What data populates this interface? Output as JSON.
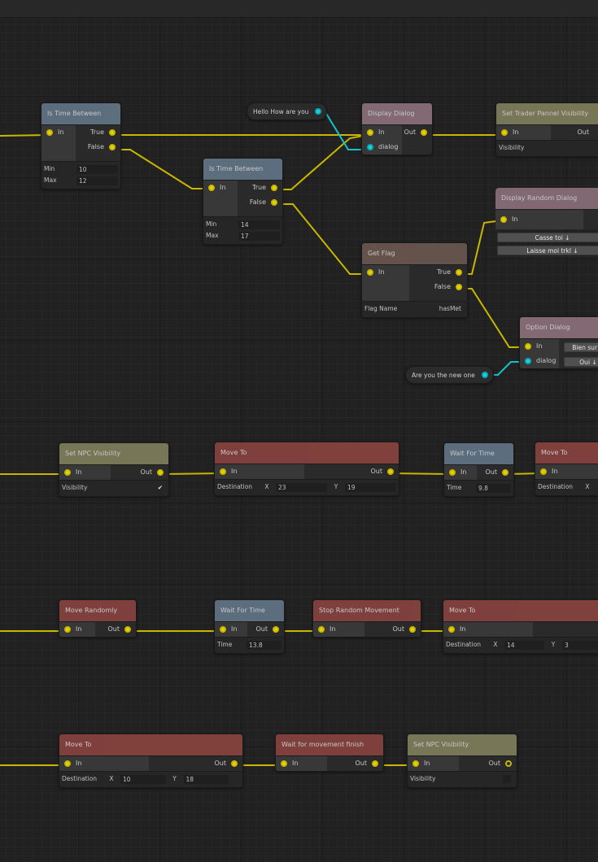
{
  "colors": {
    "exec_wire": "#c9b600",
    "data_wire": "#13c2cf",
    "header_condition": "#667a8c",
    "header_dialog": "#937580",
    "header_visibility": "#858460",
    "header_flag": "#6f5a52",
    "header_movement": "#8f4440"
  },
  "labels": {
    "in": "In",
    "out": "Out",
    "true": "True",
    "false": "False",
    "dialog": "dialog",
    "min": "Min",
    "max": "Max",
    "visibility": "Visibility",
    "destination": "Destination",
    "x": "X",
    "y": "Y",
    "time": "Time",
    "flag_name": "Flag Name",
    "check_mark": "✔"
  },
  "nodes": {
    "is_time_between_1": {
      "title": "Is Time Between",
      "min": "10",
      "max": "12"
    },
    "is_time_between_2": {
      "title": "Is Time Between",
      "min": "14",
      "max": "17"
    },
    "hello_bubble": {
      "text": "Hello How are you"
    },
    "display_dialog": {
      "title": "Display Dialog"
    },
    "set_trader_visibility": {
      "title": "Set Trader Pannel Visibility"
    },
    "display_random_dialog": {
      "title": "Display Random Dialog",
      "options": [
        "Casse toi ↓",
        "Laisse moi trkl ↓"
      ]
    },
    "get_flag": {
      "title": "Get Flag",
      "flag_name": "hasMet"
    },
    "option_dialog": {
      "title": "Option Dialog",
      "options": [
        "Bien sur ↓",
        "Oui ↓"
      ]
    },
    "are_you_bubble": {
      "text": "Are you the new one"
    },
    "set_npc_visibility_1": {
      "title": "Set NPC Visibility",
      "visibility": true
    },
    "move_to_1": {
      "title": "Move To",
      "x": "23",
      "y": "19"
    },
    "wait_for_time_1": {
      "title": "Wait For Time",
      "time": "9.8"
    },
    "move_to_2": {
      "title": "Move To"
    },
    "move_randomly": {
      "title": "Move Randomly"
    },
    "wait_for_time_2": {
      "title": "Wait For Time",
      "time": "13.8"
    },
    "stop_random_movement": {
      "title": "Stop Random Movement"
    },
    "move_to_3": {
      "title": "Move To",
      "x": "14",
      "y": "3"
    },
    "move_to_4": {
      "title": "Move To",
      "x": "10",
      "y": "18"
    },
    "wait_movement_finish": {
      "title": "Wait for movement finish"
    },
    "set_npc_visibility_2": {
      "title": "Set NPC Visibility",
      "visibility": false
    }
  }
}
